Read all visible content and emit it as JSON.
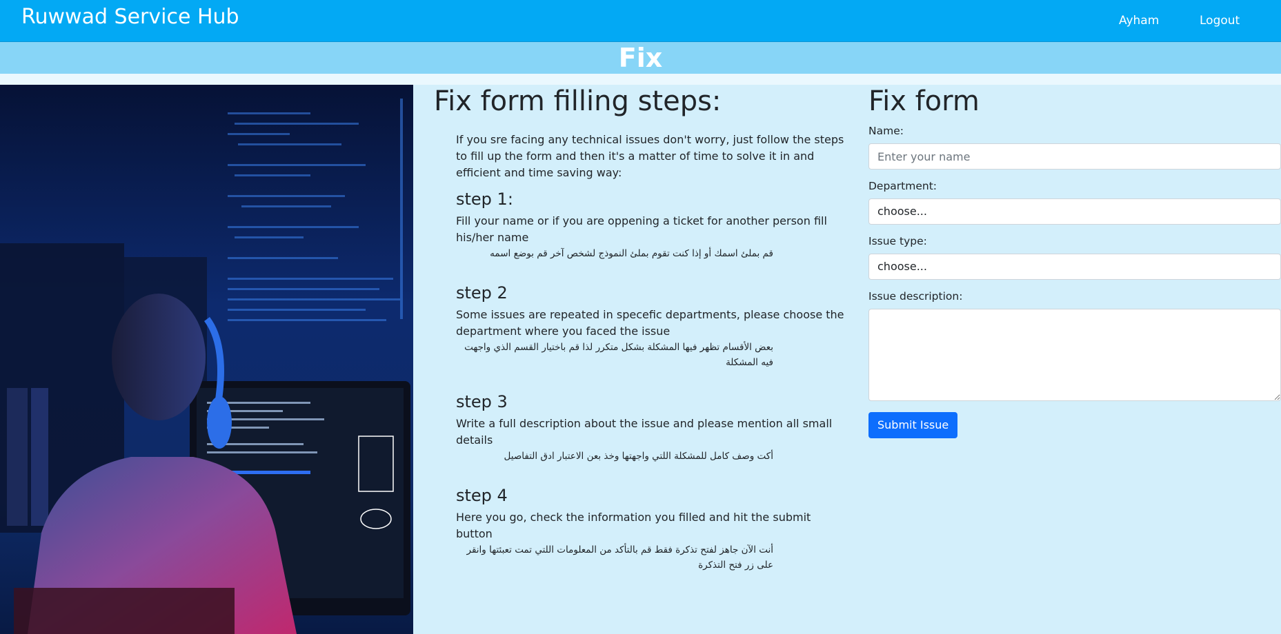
{
  "navbar": {
    "brand": "Ruwwad Service Hub",
    "user": "Ayham",
    "logout": "Logout"
  },
  "banner": {
    "title": "Fix"
  },
  "steps": {
    "heading": "Fix form filling steps:",
    "intro": "If you sre facing any technical issues don't worry, just follow the steps to fill up the form and then it's a matter of time to solve it in and efficient and time saving way:",
    "items": [
      {
        "title": "step 1:",
        "en": "Fill your name or if you are oppening a ticket for another person fill his/her name",
        "ar": "قم بملئ اسمك أو إذا كنت تقوم بملئ النموذج لشخص آخر قم بوضع اسمه"
      },
      {
        "title": "step 2",
        "en": "Some issues are repeated in specefic departments, please choose the department where you faced the issue",
        "ar": "بعض الأقسام تظهر فيها المشكلة بشكل متكرر لذا قم باختيار القسم الذي واجهت فيه المشكلة"
      },
      {
        "title": "step 3",
        "en": "Write a full description about the issue and please mention all small details",
        "ar": "أكت وصف كامل للمشكلة اللتي واجهتها وخذ بعن الاعتبار ادق التفاصيل"
      },
      {
        "title": "step 4",
        "en": "Here you go, check the information you filled and hit the submit button",
        "ar": "أنت الآن جاهز لفتح تذكرة فقط قم بالتأكد من المعلومات اللتي تمت تعبئتها وانقر على زر فتح التذكرة"
      }
    ]
  },
  "form": {
    "heading": "Fix form",
    "name_label": "Name:",
    "name_placeholder": "Enter your name",
    "department_label": "Department:",
    "department_value": "choose...",
    "issue_type_label": "Issue type:",
    "issue_type_value": "choose...",
    "description_label": "Issue description:",
    "description_value": "",
    "submit_label": "Submit Issue"
  },
  "colors": {
    "navbar": "#03a9f4",
    "banner": "#87d5f7",
    "page_background": "#d3effb",
    "submit_button": "#0d6efd"
  }
}
